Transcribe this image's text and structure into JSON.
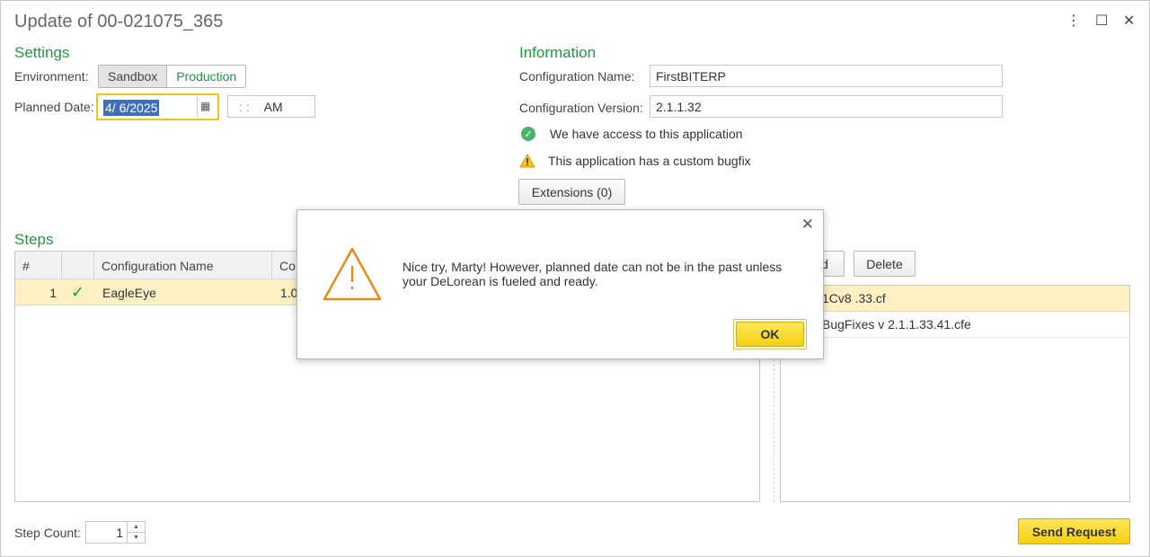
{
  "window": {
    "title": "Update of 00-021075_365",
    "controls": {
      "more": "⋮",
      "maximize": "☐",
      "close": "✕"
    }
  },
  "settings": {
    "title": "Settings",
    "environment_label": "Environment:",
    "env_options": [
      "Sandbox",
      "Production"
    ],
    "selected_env": "Production",
    "planned_date_label": "Planned Date:",
    "planned_date_value": "4/ 6/2025",
    "time_value_sep": ": :",
    "time_ampm": "AM"
  },
  "information": {
    "title": "Information",
    "config_name_label": "Configuration Name:",
    "config_name_value": "FirstBITERP",
    "config_version_label": "Configuration Version:",
    "config_version_value": "2.1.1.32",
    "access_text": "We have access to this application",
    "bugfix_text": "This application has a custom bugfix",
    "extensions_button": "Extensions (0)"
  },
  "steps": {
    "title": "Steps",
    "columns": [
      "#",
      "",
      "Configuration Name",
      "Co"
    ],
    "rows": [
      {
        "num": "1",
        "check": "✓",
        "name": "EagleEye",
        "version": "1.0"
      }
    ]
  },
  "files": {
    "add_button": "d",
    "delete_button": "Delete",
    "rows": [
      "1Cv8 .33.cf",
      "BugFixes v 2.1.1.33.41.cfe"
    ]
  },
  "footer": {
    "step_count_label": "Step Count:",
    "step_count_value": "1",
    "send_button": "Send Request"
  },
  "dialog": {
    "message": "Nice try, Marty! However, planned date can not be in the past unless your DeLorean is fueled and ready.",
    "ok_button": "OK",
    "close": "✕"
  },
  "colors": {
    "accent_green": "#1a9a3f",
    "yellow": "#f5cf0f",
    "warning_orange": "#e88a1a",
    "selection_blue": "#3e6fbd"
  }
}
